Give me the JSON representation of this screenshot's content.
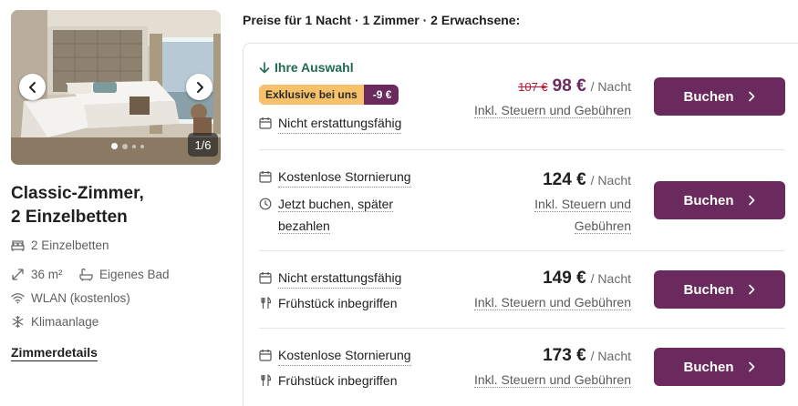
{
  "gallery": {
    "counter": "1/6",
    "image_alt": "Classic room with two single beds"
  },
  "room": {
    "title_line1": "Classic-Zimmer,",
    "title_line2": "2 Einzelbetten",
    "features": [
      {
        "icon": "bed-icon",
        "label": "2 Einzelbetten"
      },
      {
        "icon": "expand-icon",
        "label": "36 m²"
      },
      {
        "icon": "bathtub-icon",
        "label": "Eigenes Bad"
      },
      {
        "icon": "wifi-icon",
        "label": "WLAN (kostenlos)"
      },
      {
        "icon": "snowflake-icon",
        "label": "Klimaanlage"
      }
    ],
    "details_link": "Zimmerdetails"
  },
  "rates_header": "Preise für 1 Nacht · 1 Zimmer · 2 Erwachsene:",
  "rates": [
    {
      "selected_label": "Ihre Auswahl",
      "promo_label": "Exklusive bei uns",
      "promo_discount": "-9 €",
      "features": [
        {
          "icon": "calendar-icon",
          "label": "Nicht erstattungsfähig"
        }
      ],
      "old_price": "107 €",
      "price": "98 €",
      "per_night": "/ Nacht",
      "taxes": "Inkl. Steuern und Gebühren",
      "button": "Buchen"
    },
    {
      "features": [
        {
          "icon": "calendar-icon",
          "label": "Kostenlose Stornierung"
        },
        {
          "icon": "clock-icon",
          "label_line1": "Jetzt buchen, später",
          "label_line2": "bezahlen"
        }
      ],
      "price": "124 €",
      "per_night": "/ Nacht",
      "taxes_line1": "Inkl. Steuern und",
      "taxes_line2": "Gebühren",
      "button": "Buchen"
    },
    {
      "features": [
        {
          "icon": "calendar-icon",
          "label": "Nicht erstattungsfähig"
        },
        {
          "icon": "fork-knife-icon",
          "label": "Frühstück inbegriffen"
        }
      ],
      "price": "149 €",
      "per_night": "/ Nacht",
      "taxes": "Inkl. Steuern und Gebühren",
      "button": "Buchen"
    },
    {
      "features": [
        {
          "icon": "calendar-icon",
          "label": "Kostenlose Stornierung"
        },
        {
          "icon": "fork-knife-icon",
          "label": "Frühstück inbegriffen"
        }
      ],
      "price": "173 €",
      "per_night": "/ Nacht",
      "taxes": "Inkl. Steuern und Gebühren",
      "button": "Buchen"
    }
  ],
  "colors": {
    "brand": "#6b2a5d",
    "promo": "#f7c06a",
    "selected": "#1e6b52",
    "old_price": "#c8102e"
  }
}
